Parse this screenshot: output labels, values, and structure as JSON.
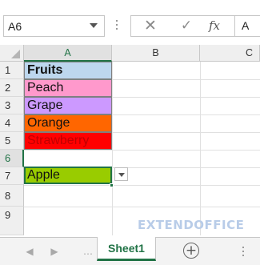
{
  "formula_bar": {
    "name_box": "A6",
    "fx_label": "fx",
    "content": "A"
  },
  "columns": [
    "A",
    "B",
    "C"
  ],
  "rows": [
    "1",
    "2",
    "3",
    "4",
    "5",
    "6",
    "7",
    "8",
    "9"
  ],
  "cells": [
    {
      "row": "1",
      "value": "Fruits",
      "fill": "#bdd7ee",
      "bold": true
    },
    {
      "row": "2",
      "value": "Peach",
      "fill": "#ff99cc",
      "bold": false
    },
    {
      "row": "3",
      "value": "Grape",
      "fill": "#cc99ff",
      "bold": false
    },
    {
      "row": "4",
      "value": "Orange",
      "fill": "#ff6600",
      "bold": false
    },
    {
      "row": "5",
      "value": "Strawberry",
      "fill": "#ff0000",
      "bold": false,
      "color": "#c00000"
    },
    {
      "row": "6",
      "value": "Apple",
      "fill": "#99cc00",
      "bold": false,
      "active": true
    }
  ],
  "watermark": "EXTENDOFFICE",
  "sheet_tabs": {
    "active": "Sheet1",
    "add_label": "+"
  },
  "colors": {
    "accent": "#217346",
    "grid": "#e0e0e0",
    "header_bg": "#efefef"
  }
}
